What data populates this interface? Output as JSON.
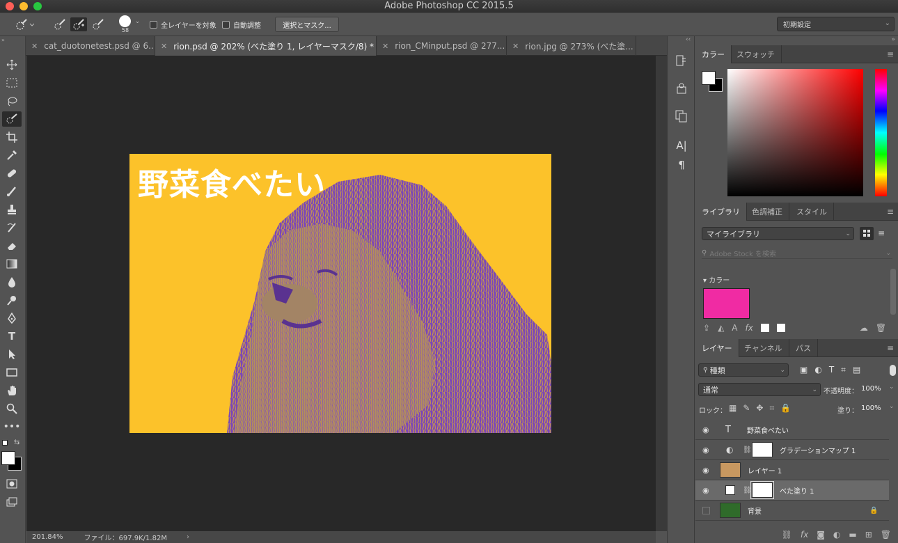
{
  "window": {
    "title": "Adobe Photoshop CC 2015.5"
  },
  "options_bar": {
    "brush_size": "58",
    "sample_all_layers_label": "全レイヤーを対象",
    "auto_enhance_label": "自動調整",
    "select_mask_label": "選択とマスク...",
    "workspace_value": "初期設定"
  },
  "tabs": [
    {
      "label": "cat_duotonetest.psd @ 6..."
    },
    {
      "label": "rion.psd @ 202% (べた塗り 1, レイヤーマスク/8) *"
    },
    {
      "label": "rion_CMinput.psd @ 277..."
    },
    {
      "label": "rion.jpg @ 273% (べた塗..."
    }
  ],
  "document": {
    "title_text": "野菜食べたい",
    "bg_color": "#FCC22A",
    "duotone_color": "#6E3FB3"
  },
  "status": {
    "zoom": "201.84%",
    "file_info": "ファイル：697.9K/1.82M"
  },
  "color_panel": {
    "tab1": "カラー",
    "tab2": "スウォッチ"
  },
  "library_panel": {
    "tab1": "ライブラリ",
    "tab2": "色調補正",
    "tab3": "スタイル",
    "library_select": "マイライブラリ",
    "search_placeholder": "Adobe Stock を検索",
    "section_label": "カラー",
    "swatch_color": "#F02BA3"
  },
  "layers_panel": {
    "tab1": "レイヤー",
    "tab2": "チャンネル",
    "tab3": "パス",
    "filter_label": "種類",
    "blend_mode": "通常",
    "opacity_label": "不透明度：",
    "opacity_value": "100%",
    "lock_label": "ロック：",
    "fill_label": "塗り：",
    "fill_value": "100%",
    "layers": [
      {
        "name": "野菜食べたい",
        "type": "text"
      },
      {
        "name": "グラデーションマップ 1",
        "type": "adjustment"
      },
      {
        "name": "レイヤー 1",
        "type": "pixel"
      },
      {
        "name": "べた塗り 1",
        "type": "fill",
        "selected": true
      },
      {
        "name": "背景",
        "type": "background"
      }
    ]
  }
}
